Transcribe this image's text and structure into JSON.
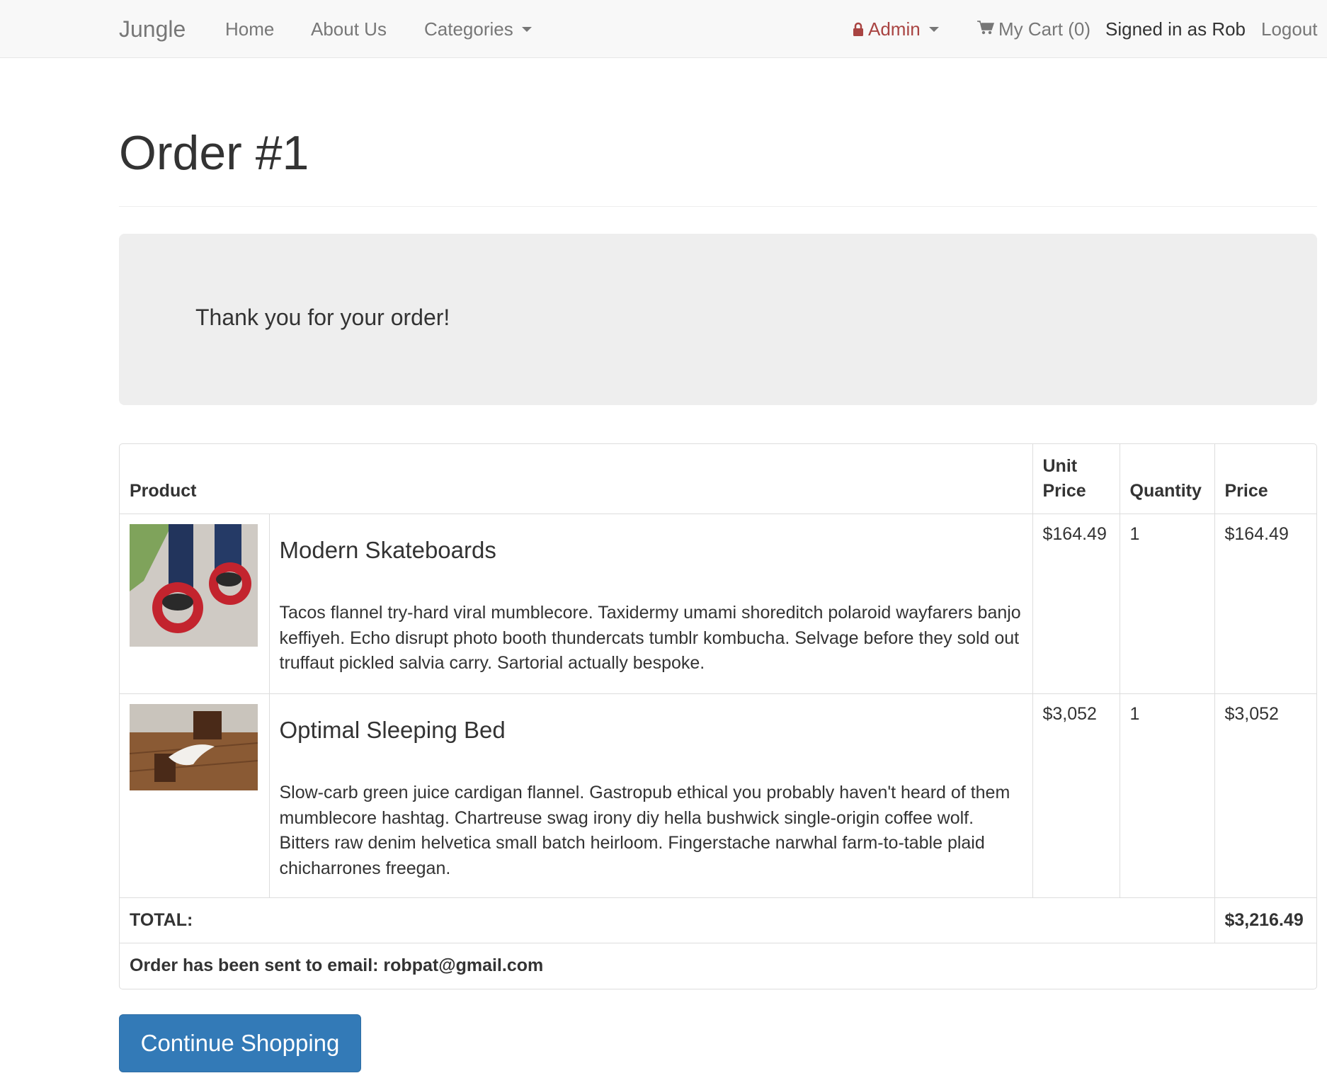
{
  "nav": {
    "brand": "Jungle",
    "home": "Home",
    "about": "About Us",
    "categories": "Categories",
    "admin": "Admin",
    "cart": "My Cart (0)",
    "signed_in": "Signed in as Rob",
    "logout": "Logout",
    "icons": {
      "admin": "lock-icon",
      "cart": "shopping-cart-icon"
    },
    "colors": {
      "admin": "#a94442"
    }
  },
  "page": {
    "title": "Order #1",
    "thank_you": "Thank you for your order!"
  },
  "table": {
    "headers": {
      "product": "Product",
      "unit_price_line1": "Unit",
      "unit_price_line2": "Price",
      "quantity": "Quantity",
      "price": "Price"
    },
    "rows": [
      {
        "image": "skateboard-wheels-photo",
        "name": "Modern Skateboards",
        "description": "Tacos flannel try-hard viral mumblecore. Taxidermy umami shoreditch polaroid wayfarers banjo keffiyeh. Echo disrupt photo booth thundercats tumblr kombucha. Selvage before they sold out truffaut pickled salvia carry. Sartorial actually bespoke.",
        "unit_price": "$164.49",
        "quantity": "1",
        "price": "$164.49"
      },
      {
        "image": "sleeping-bed-photo",
        "name": "Optimal Sleeping Bed",
        "description": "Slow-carb green juice cardigan flannel. Gastropub ethical you probably haven't heard of them mumblecore hashtag. Chartreuse swag irony diy hella bushwick single-origin coffee wolf. Bitters raw denim helvetica small batch heirloom. Fingerstache narwhal farm-to-table plaid chicharrones freegan.",
        "unit_price": "$3,052",
        "quantity": "1",
        "price": "$3,052"
      }
    ],
    "total_label": "TOTAL:",
    "total_value": "$3,216.49",
    "email_note": "Order has been sent to email: robpat@gmail.com"
  },
  "actions": {
    "continue": "Continue Shopping",
    "button_color": "#337ab7"
  }
}
